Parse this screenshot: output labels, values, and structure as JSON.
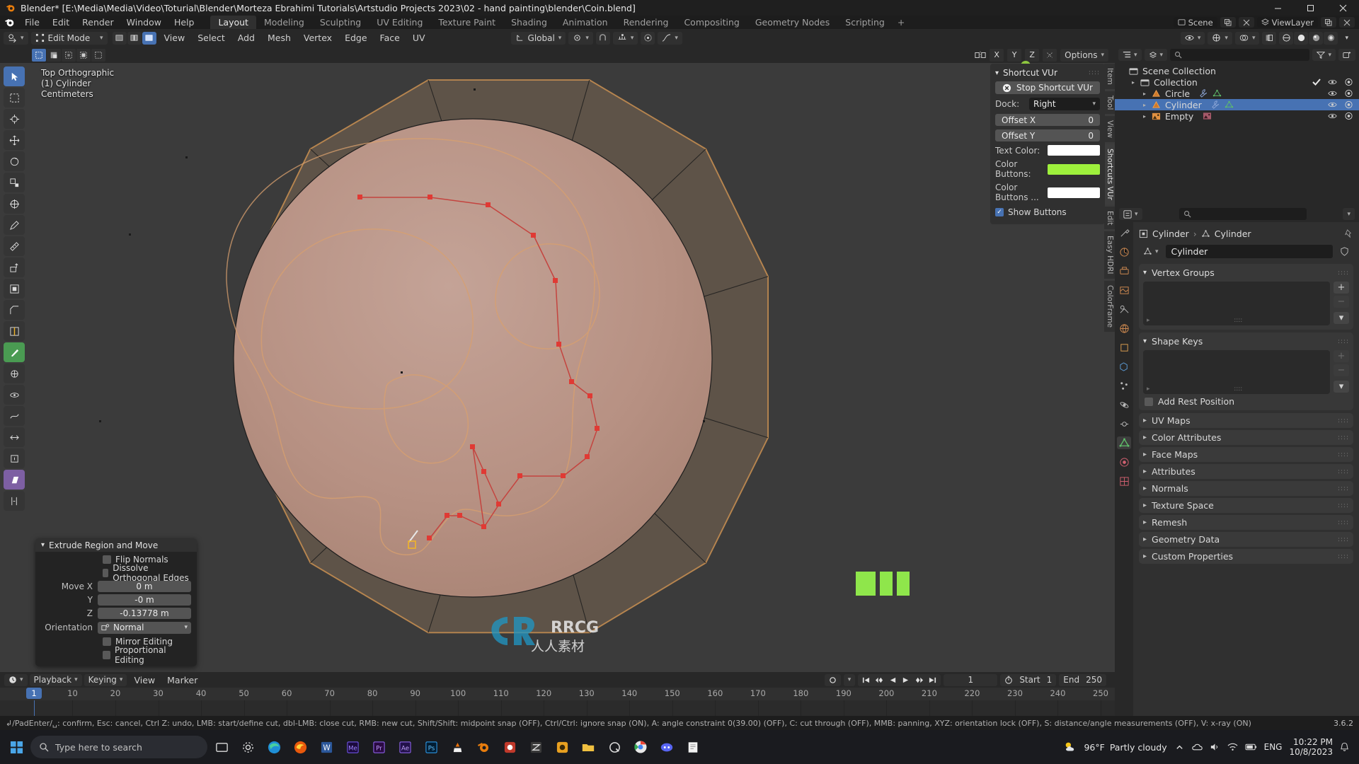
{
  "window": {
    "title": "Blender* [E:\\Media\\Media\\Video\\Toturial\\Blender\\Morteza Ebrahimi Tutorials\\Artstudio Projects 2023\\02 - hand painting\\blender\\Coin.blend]",
    "minimize": "—",
    "maximize": "☐",
    "close": "✕"
  },
  "menubar": {
    "items": [
      "File",
      "Edit",
      "Render",
      "Window",
      "Help"
    ],
    "tabs": [
      "Layout",
      "Modeling",
      "Sculpting",
      "UV Editing",
      "Texture Paint",
      "Shading",
      "Animation",
      "Rendering",
      "Compositing",
      "Geometry Nodes",
      "Scripting"
    ],
    "active_tab": "Layout",
    "add_tab": "+",
    "scene_name": "Scene",
    "viewlayer_name": "ViewLayer"
  },
  "viewport_header": {
    "mode": "Edit Mode",
    "menus": [
      "View",
      "Select",
      "Add",
      "Mesh",
      "Vertex",
      "Edge",
      "Face",
      "UV"
    ],
    "orientation": "Global",
    "snap_label": "Snap",
    "proportional_label": "Proportional Editing",
    "axis_locks": [
      "X",
      "Y",
      "Z"
    ],
    "options_label": "Options"
  },
  "viewport": {
    "overlay": {
      "view_name": "Top Orthographic",
      "object_name": "(1) Cylinder",
      "units": "Centimeters"
    },
    "gizmo_axes": [
      "X",
      "Y",
      "Z"
    ]
  },
  "vur_panel": {
    "title": "Shortcut VUr",
    "stop_button": "Stop Shortcut VUr",
    "dock_label": "Dock:",
    "dock_value": "Right",
    "offset_x_label": "Offset X",
    "offset_x_value": "0",
    "offset_y_label": "Offset Y",
    "offset_y_value": "0",
    "text_color_label": "Text Color:",
    "text_color_value": "#ffffff",
    "color_buttons_label": "Color Buttons:",
    "color_buttons_value": "#9ef03c",
    "color_buttons2_label": "Color Buttons ...",
    "color_buttons2_value": "#ffffff",
    "show_buttons_label": "Show Buttons",
    "show_buttons_checked": true
  },
  "viewport_tabs": [
    "Item",
    "Tool",
    "View",
    "Shortcuts VUr",
    "Edit",
    "Easy HDRI",
    "ColorFrame"
  ],
  "operator_panel": {
    "title": "Extrude Region and Move",
    "flip_normals": "Flip Normals",
    "dissolve": "Dissolve Orthogonal Edges",
    "move_x_label": "Move X",
    "move_x_value": "0 m",
    "move_y_label": "Y",
    "move_y_value": "-0 m",
    "move_z_label": "Z",
    "move_z_value": "-0.13778 m",
    "orientation_label": "Orientation",
    "orientation_value": "Normal",
    "mirror_editing": "Mirror Editing",
    "proportional_editing": "Proportional Editing"
  },
  "outliner": {
    "display_mode": "View Layer",
    "search_placeholder": "",
    "items": [
      {
        "label": "Scene Collection",
        "indent": 0,
        "icon": "collection-icon",
        "selected": false,
        "has_arrow": false
      },
      {
        "label": "Collection",
        "indent": 1,
        "icon": "collection-icon",
        "selected": false,
        "has_arrow": true
      },
      {
        "label": "Circle",
        "indent": 2,
        "icon": "mesh-icon",
        "selected": false,
        "has_arrow": true
      },
      {
        "label": "Cylinder",
        "indent": 2,
        "icon": "mesh-icon",
        "selected": true,
        "has_arrow": true
      },
      {
        "label": "Empty",
        "indent": 2,
        "icon": "empty-image-icon",
        "selected": false,
        "has_arrow": true
      }
    ]
  },
  "properties": {
    "breadcrumb_object": "Cylinder",
    "breadcrumb_data": "Cylinder",
    "name_value": "Cylinder",
    "vertex_groups": {
      "title": "Vertex Groups"
    },
    "shape_keys": {
      "title": "Shape Keys",
      "add_rest_position": "Add Rest Position"
    },
    "closed_panels": [
      "UV Maps",
      "Color Attributes",
      "Face Maps",
      "Attributes",
      "Normals",
      "Texture Space",
      "Remesh",
      "Geometry Data",
      "Custom Properties"
    ]
  },
  "timeline": {
    "menus": [
      "Playback",
      "Keying",
      "View",
      "Marker"
    ],
    "current_frame": "1",
    "start_label": "Start",
    "start_value": "1",
    "end_label": "End",
    "end_value": "250",
    "ticks": [
      {
        "label": "1",
        "value": 1
      },
      {
        "label": "10",
        "value": 10
      },
      {
        "label": "20",
        "value": 20
      },
      {
        "label": "30",
        "value": 30
      },
      {
        "label": "40",
        "value": 40
      },
      {
        "label": "50",
        "value": 50
      },
      {
        "label": "60",
        "value": 60
      },
      {
        "label": "70",
        "value": 70
      },
      {
        "label": "80",
        "value": 80
      },
      {
        "label": "90",
        "value": 90
      },
      {
        "label": "100",
        "value": 100
      },
      {
        "label": "110",
        "value": 110
      },
      {
        "label": "120",
        "value": 120
      },
      {
        "label": "130",
        "value": 130
      },
      {
        "label": "140",
        "value": 140
      },
      {
        "label": "150",
        "value": 150
      },
      {
        "label": "160",
        "value": 160
      },
      {
        "label": "170",
        "value": 170
      },
      {
        "label": "180",
        "value": 180
      },
      {
        "label": "190",
        "value": 190
      },
      {
        "label": "200",
        "value": 200
      },
      {
        "label": "210",
        "value": 210
      },
      {
        "label": "220",
        "value": 220
      },
      {
        "label": "230",
        "value": 230
      },
      {
        "label": "240",
        "value": 240
      },
      {
        "label": "250",
        "value": 250
      }
    ]
  },
  "statusbar": {
    "hints": "↲/PadEnter/␣: confirm, Esc: cancel, Ctrl Z: undo, LMB: start/define cut, dbl-LMB: close cut, RMB: new cut, Shift/Shift: midpoint snap (OFF), Ctrl/Ctrl: ignore snap (ON), A: angle constraint 0(39.00) (OFF), C: cut through (OFF), MMB: panning, XYZ: orientation lock (OFF), S: distance/angle measurements (OFF), V: x-ray (ON)",
    "version": "3.6.2"
  },
  "taskbar": {
    "search_placeholder": "Type here to search",
    "weather_temp": "96°F",
    "weather_desc": "Partly cloudy",
    "lang": "ENG",
    "time": "10:22 PM",
    "date": "10/8/2023",
    "apps": [
      "word-icon",
      "me-icon",
      "premiere-icon",
      "after-effects-icon",
      "photoshop-icon"
    ]
  }
}
